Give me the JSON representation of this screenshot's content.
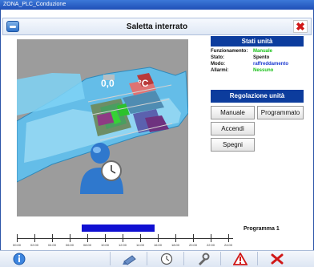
{
  "window": {
    "title": "ZONA_PLC_Conduzione"
  },
  "header": {
    "title": "Saletta interrato"
  },
  "floor": {
    "temperature": "0,0",
    "unit": "°C"
  },
  "stati": {
    "title": "Stati unità",
    "rows": [
      {
        "label": "Funzionamento:",
        "value": "Manuale",
        "color": "#18c018"
      },
      {
        "label": "Stato:",
        "value": "Spento",
        "color": "#111111"
      },
      {
        "label": "Modo:",
        "value": "raffreddamento",
        "color": "#1a38d0"
      },
      {
        "label": "Allarmi:",
        "value": "Nessuno",
        "color": "#18c018"
      }
    ]
  },
  "regolazione": {
    "title": "Regolazione unità",
    "buttons": [
      "Manuale",
      "Programmato",
      "Accendi",
      "Spegni"
    ]
  },
  "program": {
    "label": "Programma 1",
    "active_start_hour": 8,
    "active_end_hour": 14,
    "ticks": [
      "00:00",
      "02:00",
      "04:00",
      "06:00",
      "08:00",
      "10:00",
      "12:00",
      "14:00",
      "16:00",
      "18:00",
      "20:00",
      "22:00",
      "24:00"
    ]
  },
  "footer": {
    "icons": [
      "info-icon",
      "broom-icon",
      "clock-icon",
      "wrench-icon",
      "warning-icon",
      "close-icon"
    ]
  }
}
